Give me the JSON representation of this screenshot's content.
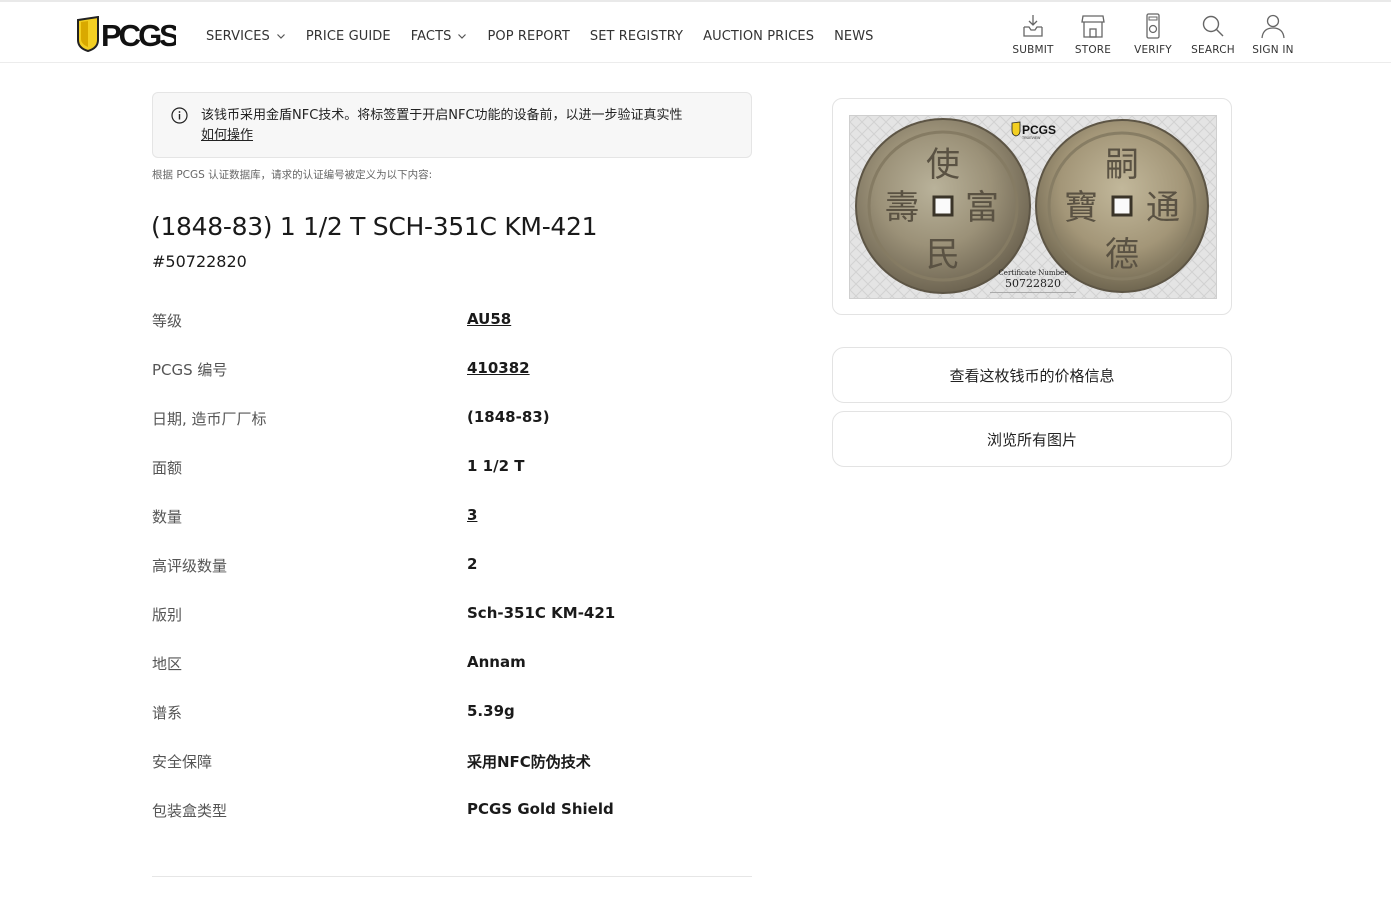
{
  "header": {
    "logo_text": "PCGS",
    "nav": [
      {
        "label": "SERVICES",
        "dropdown": true
      },
      {
        "label": "PRICE GUIDE",
        "dropdown": false
      },
      {
        "label": "FACTS",
        "dropdown": true
      },
      {
        "label": "POP REPORT",
        "dropdown": false
      },
      {
        "label": "SET REGISTRY",
        "dropdown": false
      },
      {
        "label": "AUCTION PRICES",
        "dropdown": false
      },
      {
        "label": "NEWS",
        "dropdown": false
      }
    ],
    "tools": [
      {
        "label": "SUBMIT",
        "icon": "submit-icon"
      },
      {
        "label": "STORE",
        "icon": "store-icon"
      },
      {
        "label": "VERIFY",
        "icon": "verify-icon"
      },
      {
        "label": "SEARCH",
        "icon": "search-icon"
      },
      {
        "label": "SIGN IN",
        "icon": "user-icon"
      }
    ]
  },
  "notice": {
    "text": "该钱币采用金盾NFC技术。将标签置于开启NFC功能的设备前，以进一步验证真实性",
    "link": "如何操作"
  },
  "db_note": "根据 PCGS 认证数据库，请求的认证编号被定义为以下内容:",
  "coin": {
    "title": "(1848-83) 1 1/2 T SCH-351C KM-421",
    "cert_number": "#50722820"
  },
  "attributes": [
    {
      "label": "等级",
      "value": "AU58",
      "link": true
    },
    {
      "label": "PCGS 编号",
      "value": "410382",
      "link": true
    },
    {
      "label": "日期, 造币厂厂标",
      "value": "(1848-83)",
      "link": false
    },
    {
      "label": "面额",
      "value": "1 1/2 T",
      "link": false
    },
    {
      "label": "数量",
      "value": "3",
      "link": true
    },
    {
      "label": "高评级数量",
      "value": "2",
      "link": false
    },
    {
      "label": "版别",
      "value": "Sch-351C KM-421",
      "link": false
    },
    {
      "label": "地区",
      "value": "Annam",
      "link": false
    },
    {
      "label": "谱系",
      "value": "5.39g",
      "link": false
    },
    {
      "label": "安全保障",
      "value": "采用NFC防伪技术",
      "link": false
    },
    {
      "label": "包装盒类型",
      "value": "PCGS Gold Shield",
      "link": false
    }
  ],
  "image": {
    "brand": "PCGS",
    "brand_sub": "TRUEVIEW",
    "obverse_chars": [
      "使",
      "富",
      "民",
      "壽"
    ],
    "reverse_chars": [
      "嗣",
      "通",
      "德",
      "寶"
    ],
    "cert_label": "Certificate Number",
    "cert_number": "50722820"
  },
  "buttons": {
    "price_info": "查看这枚钱币的价格信息",
    "all_images": "浏览所有图片"
  }
}
